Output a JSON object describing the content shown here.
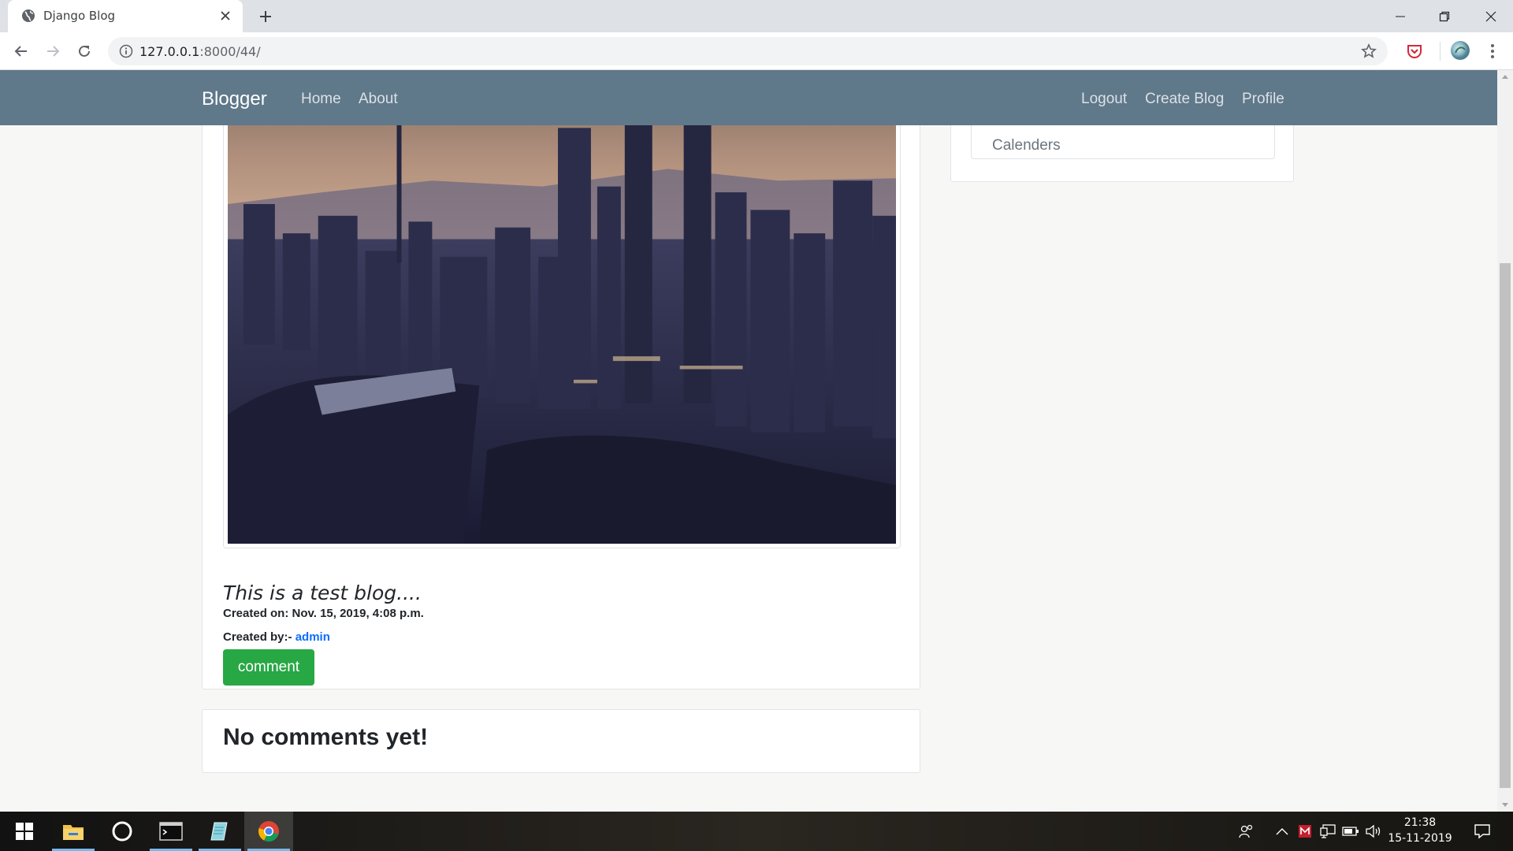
{
  "browser": {
    "tab_title": "Django Blog",
    "url_host": "127.0.0.1",
    "url_path": ":8000/44/"
  },
  "navbar": {
    "brand": "Blogger",
    "links_left": [
      "Home",
      "About"
    ],
    "links_right": [
      "Logout",
      "Create Blog",
      "Profile"
    ],
    "background_color": "#5f788a"
  },
  "post": {
    "body": "This is a test blog....",
    "created_on_label": "Created on:",
    "created_on_value": "Nov. 15, 2019, 4:08 p.m.",
    "created_by_label": "Created by:-",
    "author": "admin",
    "comment_button": "comment",
    "comment_button_color": "#28a745"
  },
  "comments": {
    "title": "No comments yet!"
  },
  "sidebar": {
    "item_label": "Calenders"
  },
  "taskbar": {
    "time": "21:38",
    "date": "15-11-2019",
    "pinned": [
      "windows-start-icon",
      "file-explorer-icon",
      "cortana-icon",
      "terminal-icon",
      "notepad-icon",
      "chrome-icon"
    ]
  }
}
